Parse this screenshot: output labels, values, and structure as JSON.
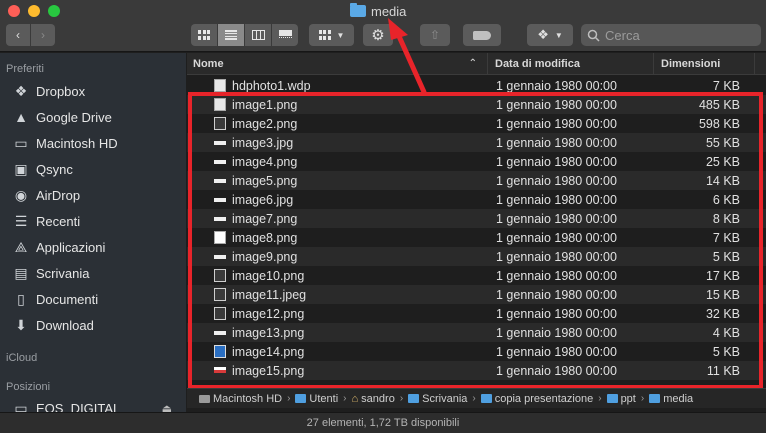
{
  "window": {
    "title": "media"
  },
  "toolbar": {
    "back_label": "‹",
    "forward_label": "›",
    "search_placeholder": "Cerca"
  },
  "sidebar": {
    "sections": {
      "favorites": "Preferiti",
      "icloud": "iCloud",
      "locations": "Posizioni"
    },
    "items": [
      {
        "label": "Dropbox",
        "icon": "dropbox-icon"
      },
      {
        "label": "Google Drive",
        "icon": "google-drive-icon"
      },
      {
        "label": "Macintosh HD",
        "icon": "hard-drive-icon"
      },
      {
        "label": "Qsync",
        "icon": "folder-icon"
      },
      {
        "label": "AirDrop",
        "icon": "airdrop-icon"
      },
      {
        "label": "Recenti",
        "icon": "recents-icon"
      },
      {
        "label": "Applicazioni",
        "icon": "applications-icon"
      },
      {
        "label": "Scrivania",
        "icon": "desktop-icon"
      },
      {
        "label": "Documenti",
        "icon": "documents-icon"
      },
      {
        "label": "Download",
        "icon": "download-icon"
      }
    ],
    "location_item": "EOS_DIGITAL"
  },
  "columns": {
    "name": "Nome",
    "date": "Data di modifica",
    "size": "Dimensioni"
  },
  "files": [
    {
      "name": "hdphoto1.wdp",
      "date": "1 gennaio 1980 00:00",
      "size": "7 KB"
    },
    {
      "name": "image1.png",
      "date": "1 gennaio 1980 00:00",
      "size": "485 KB"
    },
    {
      "name": "image2.png",
      "date": "1 gennaio 1980 00:00",
      "size": "598 KB"
    },
    {
      "name": "image3.jpg",
      "date": "1 gennaio 1980 00:00",
      "size": "55 KB"
    },
    {
      "name": "image4.png",
      "date": "1 gennaio 1980 00:00",
      "size": "25 KB"
    },
    {
      "name": "image5.png",
      "date": "1 gennaio 1980 00:00",
      "size": "14 KB"
    },
    {
      "name": "image6.jpg",
      "date": "1 gennaio 1980 00:00",
      "size": "6 KB"
    },
    {
      "name": "image7.png",
      "date": "1 gennaio 1980 00:00",
      "size": "8 KB"
    },
    {
      "name": "image8.png",
      "date": "1 gennaio 1980 00:00",
      "size": "7 KB"
    },
    {
      "name": "image9.png",
      "date": "1 gennaio 1980 00:00",
      "size": "5 KB"
    },
    {
      "name": "image10.png",
      "date": "1 gennaio 1980 00:00",
      "size": "17 KB"
    },
    {
      "name": "image11.jpeg",
      "date": "1 gennaio 1980 00:00",
      "size": "15 KB"
    },
    {
      "name": "image12.png",
      "date": "1 gennaio 1980 00:00",
      "size": "32 KB"
    },
    {
      "name": "image13.png",
      "date": "1 gennaio 1980 00:00",
      "size": "4 KB"
    },
    {
      "name": "image14.png",
      "date": "1 gennaio 1980 00:00",
      "size": "5 KB"
    },
    {
      "name": "image15.png",
      "date": "1 gennaio 1980 00:00",
      "size": "11 KB"
    }
  ],
  "path": [
    "Macintosh HD",
    "Utenti",
    "sandro",
    "Scrivania",
    "copia presentazione",
    "ppt",
    "media"
  ],
  "status": "27 elementi, 1,72 TB disponibili",
  "colors": {
    "highlight": "#e8242a",
    "folder": "#5aa9e6"
  }
}
